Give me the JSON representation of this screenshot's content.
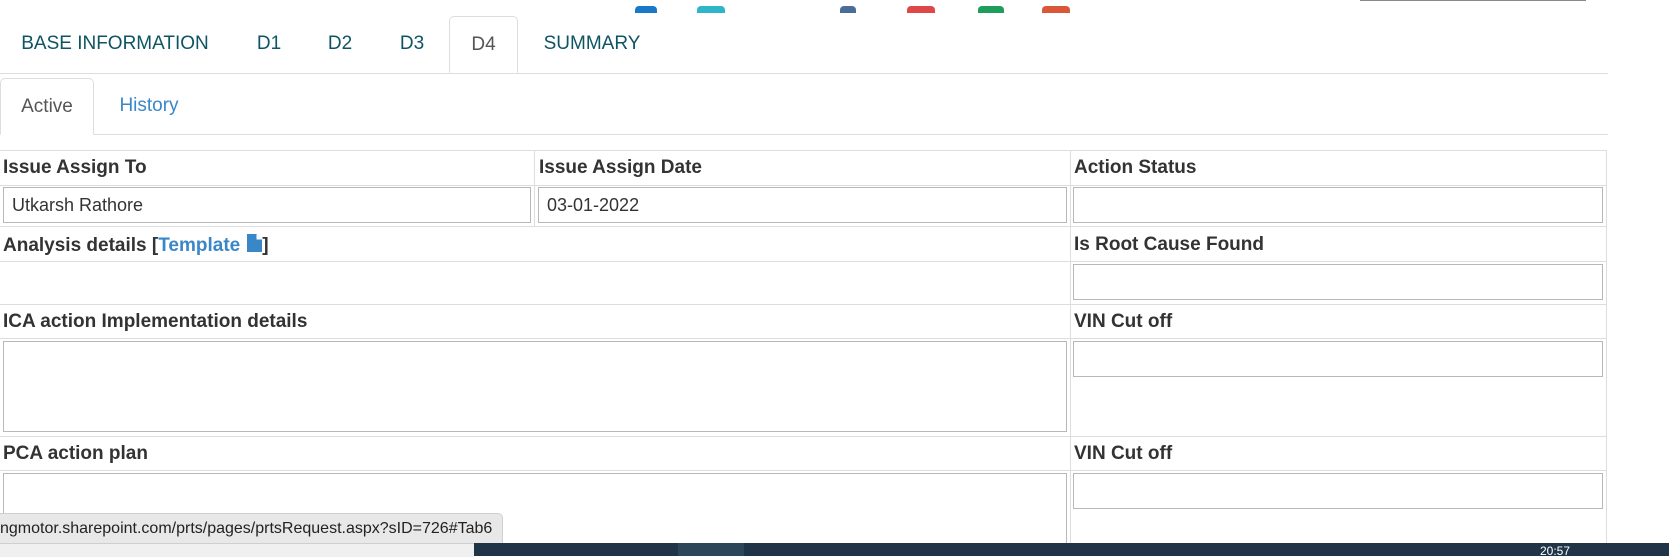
{
  "main_tabs": [
    "BASE INFORMATION",
    "D1",
    "D2",
    "D3",
    "D4",
    "SUMMARY"
  ],
  "main_tab_active": "D4",
  "sub_tabs": [
    "Active",
    "History"
  ],
  "sub_tab_active": "Active",
  "form": {
    "issue_assign_to_label": "Issue Assign To",
    "issue_assign_to_value": "Utkarsh Rathore",
    "issue_assign_date_label": "Issue Assign Date",
    "issue_assign_date_value": "03-01-2022",
    "action_status_label": "Action Status",
    "action_status_value": "",
    "analysis_label_prefix": "Analysis details [",
    "analysis_template_link": "Template",
    "analysis_label_suffix": "]",
    "root_cause_label": "Is Root Cause Found",
    "root_cause_value": "",
    "ica_label": "ICA action Implementation details",
    "ica_value": "",
    "vin_cutoff_label_1": "VIN Cut off",
    "vin_cutoff_value_1": "",
    "pca_label": "PCA action plan",
    "pca_value": "",
    "vin_cutoff_label_2": "VIN Cut off",
    "vin_cutoff_value_2": ""
  },
  "status_bar_url": "ngmotor.sharepoint.com/prts/pages/prtsRequest.aspx?sID=726#Tab6",
  "taskbar_clock": "20:57",
  "colors": {
    "tab_text": "#0e5463",
    "link": "#3a87c8",
    "border": "#dddddd",
    "taskbar": "#1f3547"
  },
  "icons": [
    "document-icon"
  ]
}
